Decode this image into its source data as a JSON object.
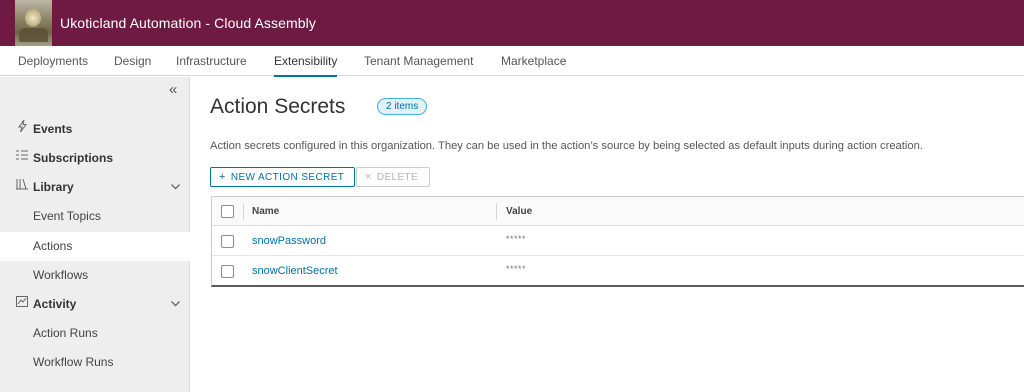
{
  "header": {
    "title": "Ukoticland Automation - Cloud Assembly",
    "background": "#6e1a42"
  },
  "nav": {
    "tabs": [
      {
        "label": "Deployments"
      },
      {
        "label": "Design"
      },
      {
        "label": "Infrastructure"
      },
      {
        "label": "Extensibility",
        "active": true
      },
      {
        "label": "Tenant Management"
      },
      {
        "label": "Marketplace"
      }
    ]
  },
  "sidebar": {
    "collapse_icon": "«",
    "items": [
      {
        "label": "Events",
        "icon": "lightning-icon",
        "type": "section"
      },
      {
        "label": "Subscriptions",
        "icon": "subscriptions-icon",
        "type": "section"
      },
      {
        "label": "Library",
        "icon": "library-icon",
        "type": "section",
        "expanded": true
      },
      {
        "label": "Event Topics",
        "type": "child"
      },
      {
        "label": "Actions",
        "type": "child",
        "selected": true
      },
      {
        "label": "Workflows",
        "type": "child"
      },
      {
        "label": "Activity",
        "icon": "activity-icon",
        "type": "section",
        "expanded": true
      },
      {
        "label": "Action Runs",
        "type": "child"
      },
      {
        "label": "Workflow Runs",
        "type": "child"
      }
    ]
  },
  "main": {
    "title": "Action Secrets",
    "count_badge": "2 items",
    "description": "Action secrets configured in this organization. They can be used in the action’s source by being selected as default inputs during action creation.",
    "buttons": {
      "new_label": "NEW ACTION SECRET",
      "new_icon": "+",
      "delete_label": "DELETE",
      "delete_icon": "×"
    },
    "table": {
      "columns": [
        "Name",
        "Value"
      ],
      "rows": [
        {
          "name": "snowPassword",
          "value": "*****"
        },
        {
          "name": "snowClientSecret",
          "value": "*****"
        }
      ]
    }
  },
  "colors": {
    "accent": "#0072a3",
    "header": "#6e1a42",
    "sidebar_bg": "#eeeeee"
  }
}
